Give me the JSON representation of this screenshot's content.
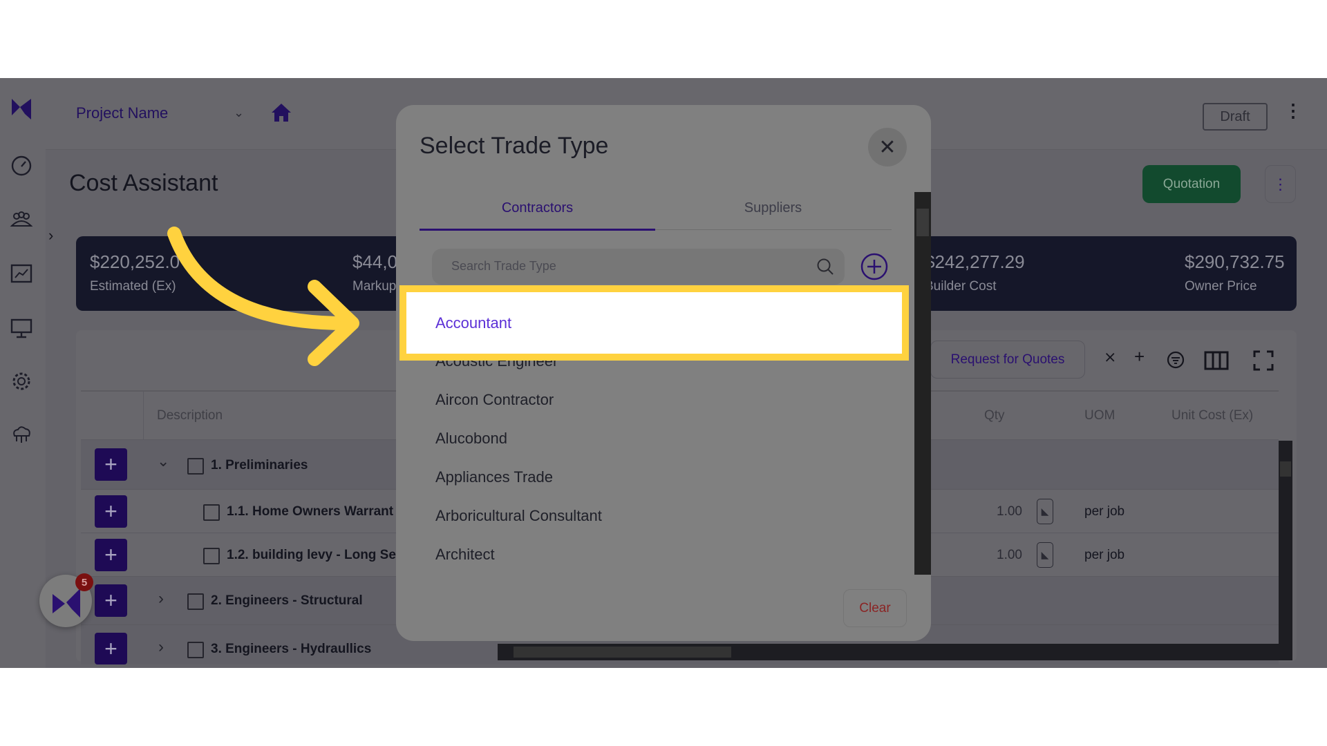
{
  "header": {
    "project_name": "Project Name",
    "status": "Draft"
  },
  "page": {
    "title": "Cost Assistant",
    "quotation_button": "Quotation"
  },
  "summary": [
    {
      "value": "$220,252.0",
      "label": "Estimated (Ex)"
    },
    {
      "value": "$44,0",
      "label": "Markup"
    },
    {
      "value": "$242,277.29",
      "label": "Builder Cost"
    },
    {
      "value": "$290,732.75",
      "label": "Owner Price"
    }
  ],
  "toolbar": {
    "request_quotes": "Request for Quotes"
  },
  "table": {
    "columns": [
      "Description",
      "Qty",
      "UOM",
      "Unit Cost (Ex)"
    ],
    "rows": [
      {
        "description": "1. Preliminaries",
        "qty": "",
        "uom": ""
      },
      {
        "description": "1.1. Home Owners Warrant",
        "qty": "1.00",
        "uom": "per job"
      },
      {
        "description": "1.2. building levy - Long Se",
        "qty": "1.00",
        "uom": "per job"
      },
      {
        "description": "2. Engineers - Structural",
        "qty": "",
        "uom": ""
      },
      {
        "description": "3. Engineers - Hydraullics",
        "qty": "",
        "uom": ""
      }
    ]
  },
  "chat_badge": "5",
  "modal": {
    "title": "Select Trade Type",
    "tabs": [
      {
        "label": "Contractors",
        "active": true
      },
      {
        "label": "Suppliers",
        "active": false
      }
    ],
    "search_placeholder": "Search Trade Type",
    "items": [
      "Accountant",
      "Acoustic Engineer",
      "Aircon Contractor",
      "Alucobond",
      "Appliances Trade",
      "Arboricultural Consultant",
      "Architect"
    ],
    "highlighted_item": "Accountant",
    "clear_button": "Clear"
  },
  "colors": {
    "accent": "#4a22c8",
    "highlight": "#ffd23f",
    "quotation": "#124a2e",
    "clear": "#c0392b"
  }
}
